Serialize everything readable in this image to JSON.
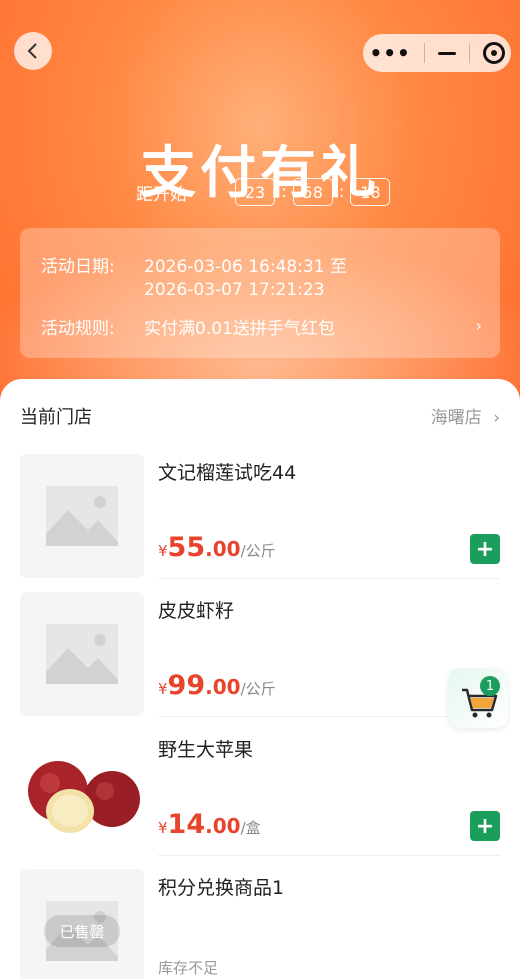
{
  "nav": {
    "back_icon": "chevron-left-icon",
    "capsule": {
      "more_icon": "more-dots-icon",
      "minimize_icon": "minus-icon",
      "close_icon": "target-icon"
    }
  },
  "hero": {
    "title": "支付有礼",
    "countdown_label": "距开始",
    "countdown": {
      "hours": "23",
      "minutes": "58",
      "seconds": "18"
    }
  },
  "activity": {
    "date_label": "活动日期:",
    "date_value_line1": "2026-03-06 16:48:31 至",
    "date_value_line2": "2026-03-07 17:21:23",
    "rule_label": "活动规则:",
    "rule_value": "实付满0.01送拼手气红包",
    "chevron": "›"
  },
  "store": {
    "label": "当前门店",
    "name": "海曙店",
    "chevron": "›"
  },
  "products": [
    {
      "name": "文记榴莲试吃44",
      "currency": "¥",
      "int": "55",
      "dec": ".00",
      "unit": "/公斤",
      "image": "placeholder-image-icon"
    },
    {
      "name": "皮皮虾籽",
      "currency": "¥",
      "int": "99",
      "dec": ".00",
      "unit": "/公斤",
      "image": "placeholder-image-icon"
    },
    {
      "name": "野生大苹果",
      "currency": "¥",
      "int": "14",
      "dec": ".00",
      "unit": "/盒",
      "image": "apple-image"
    },
    {
      "name": "积分兑换商品1",
      "stock": "库存不足",
      "soldout": "已售罄",
      "image": "placeholder-image-icon"
    }
  ],
  "add_button": "+",
  "cart": {
    "count": "1",
    "icon": "cart-icon"
  },
  "colors": {
    "accent": "#ff6a2b",
    "price": "#e8432b",
    "green": "#1b9d5c"
  }
}
